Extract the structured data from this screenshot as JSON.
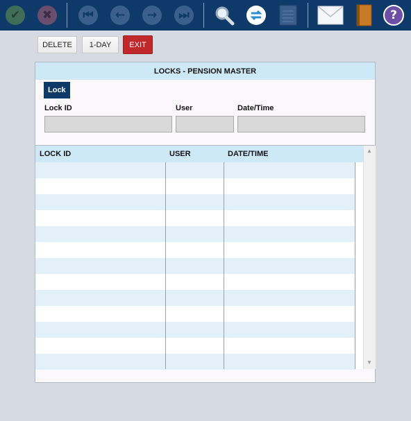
{
  "toolbar": {
    "icons": [
      "check-icon",
      "cancel-icon",
      "first-record-icon",
      "prev-record-icon",
      "next-record-icon",
      "last-record-icon",
      "search-icon",
      "refresh-icon",
      "notepad-icon",
      "mail-icon",
      "book-icon",
      "help-icon"
    ],
    "help_glyph": "?"
  },
  "actions": {
    "delete_label": "DELETE",
    "oneday_label": "1-DAY",
    "exit_label": "EXIT"
  },
  "panel": {
    "title": "LOCKS - PENSION MASTER",
    "tab_label": "Lock",
    "fields": {
      "lock_id_label": "Lock ID",
      "lock_id_value": "",
      "user_label": "User",
      "user_value": "",
      "datetime_label": "Date/Time",
      "datetime_value": ""
    }
  },
  "grid": {
    "columns": [
      "LOCK ID",
      "USER",
      "DATE/TIME"
    ],
    "rows": []
  },
  "colors": {
    "toolbar": "#0e3a6a",
    "header_bg": "#cde9f8",
    "exit": "#c0282a",
    "row_alt": "#e1f1f7"
  }
}
